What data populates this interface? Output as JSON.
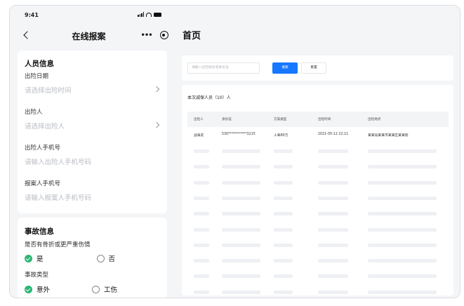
{
  "status_bar": {
    "time": "9:41"
  },
  "navbar": {
    "title": "在线报案",
    "more_icon": "more-dots-icon",
    "target_icon": "target-icon"
  },
  "person_info": {
    "title": "人员信息",
    "fields": [
      {
        "label": "出险日期",
        "placeholder": "请选择出险时间",
        "has_chevron": true
      },
      {
        "label": "出险人",
        "placeholder": "请选择出险人",
        "has_chevron": true
      },
      {
        "label": "出险人手机号",
        "placeholder": "请输入出险人手机号码",
        "has_chevron": false
      },
      {
        "label": "报案人手机号",
        "placeholder": "请输入报案人手机号码",
        "has_chevron": false
      }
    ]
  },
  "accident_info": {
    "title": "事故信息",
    "q1": {
      "label": "是否有骨折或更严重伤情",
      "yes": "是",
      "no": "否",
      "selected": "yes"
    },
    "q2": {
      "label": "事故类型",
      "opt1": "意外",
      "opt2": "工伤",
      "selected": "opt1"
    }
  },
  "web": {
    "page_title": "首页",
    "search": {
      "placeholder": "请输入出险姓名或身份证",
      "search_label": "搜索",
      "reset_label": "重置"
    },
    "table": {
      "caption": "本次减保人员（10）人",
      "columns": [
        "出险人",
        "身份证",
        "方案类型",
        "出险时间",
        "出险地点"
      ],
      "rows": [
        [
          "战海友",
          "530***********3215",
          "人寿80万",
          "2021-05-12 22:11",
          "某某省某某市某某区某某街"
        ]
      ],
      "placeholder_rows": 10
    }
  },
  "colors": {
    "primary": "#1677ff",
    "selected_radio": "#2bb673",
    "background": "#f4f5f7"
  }
}
